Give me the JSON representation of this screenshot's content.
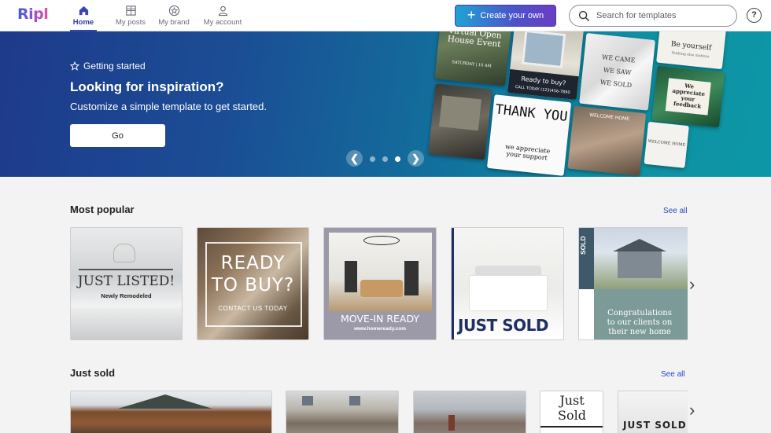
{
  "brand": {
    "logo": "Ripl"
  },
  "nav": {
    "items": [
      {
        "label": "Home",
        "icon": "home-icon"
      },
      {
        "label": "My posts",
        "icon": "grid-icon"
      },
      {
        "label": "My brand",
        "icon": "star-badge-icon"
      },
      {
        "label": "My account",
        "icon": "person-icon"
      }
    ],
    "create_label": "Create your own",
    "search_placeholder": "Search for templates",
    "help_label": "?"
  },
  "hero": {
    "kicker": "Getting started",
    "title": "Looking for inspiration?",
    "subtitle": "Customize a simple template to get started.",
    "button": "Go",
    "carousel": {
      "slides": 4,
      "active_slide": 3
    },
    "collage": {
      "virtual": "Virtual Open House Event",
      "virtual_small": "SATURDAY | 10 AM",
      "ready": "Ready to buy?",
      "ready_phone": "CALL TODAY (123)456-7890",
      "came": [
        "WE CAME",
        "WE SAW",
        "WE SOLD"
      ],
      "be_yourself": "Be yourself",
      "be_yourself_small": "Nothing else matters",
      "feedback": "We appreciate your feedback",
      "thank": "THANK YOU",
      "thank_small": "we appreciate your support",
      "welcome_home": "WELCOME HOME",
      "welcome_home2": "WELCOME HOME"
    }
  },
  "popular": {
    "title": "Most popular",
    "see_all": "See all",
    "cards": [
      {
        "line1": "JUST LISTED!",
        "line2": "Newly Remodeled"
      },
      {
        "line1": "READY",
        "line2": "TO BUY?",
        "line3": "CONTACT US TODAY"
      },
      {
        "line1": "MOVE-IN READY",
        "line2": "www.homeready.com"
      },
      {
        "line1": "JUST SOLD"
      },
      {
        "side": "SOLD",
        "line1": "Congratulations to our clients on their new home"
      }
    ]
  },
  "just_sold": {
    "title": "Just sold",
    "see_all": "See all",
    "cards": [
      {
        "line1": ""
      },
      {
        "line1": ""
      },
      {
        "line1": ""
      },
      {
        "line1": "Just Sold"
      },
      {
        "line1": "JUST SOLD"
      }
    ]
  },
  "colors": {
    "accent": "#3a44b3",
    "link": "#2b49c2",
    "hero_start": "#1e3a8a",
    "hero_end": "#0d97a6"
  }
}
